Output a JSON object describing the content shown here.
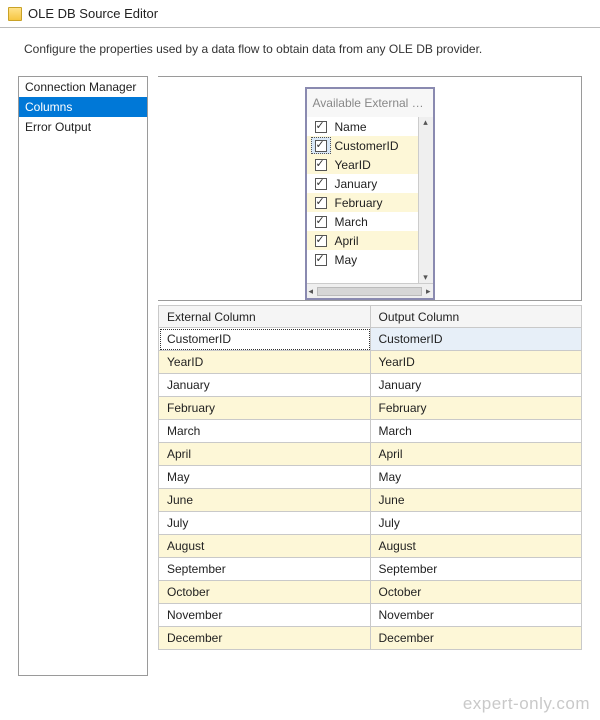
{
  "window": {
    "title": "OLE DB Source Editor"
  },
  "description": "Configure the properties used by a data flow to obtain data from any OLE DB provider.",
  "sidebar": {
    "items": [
      {
        "label": "Connection Manager",
        "selected": false
      },
      {
        "label": "Columns",
        "selected": true
      },
      {
        "label": "Error Output",
        "selected": false
      }
    ]
  },
  "available": {
    "title": "Available External C...",
    "columns": [
      {
        "label": "Name",
        "checked": true,
        "stripe": false,
        "selected": false
      },
      {
        "label": "CustomerID",
        "checked": true,
        "stripe": true,
        "selected": true
      },
      {
        "label": "YearID",
        "checked": true,
        "stripe": true,
        "selected": false
      },
      {
        "label": "January",
        "checked": true,
        "stripe": false,
        "selected": false
      },
      {
        "label": "February",
        "checked": true,
        "stripe": true,
        "selected": false
      },
      {
        "label": "March",
        "checked": true,
        "stripe": false,
        "selected": false
      },
      {
        "label": "April",
        "checked": true,
        "stripe": true,
        "selected": false
      },
      {
        "label": "May",
        "checked": true,
        "stripe": false,
        "selected": false
      }
    ]
  },
  "mapping": {
    "headers": {
      "external": "External Column",
      "output": "Output Column"
    },
    "rows": [
      {
        "external": "CustomerID",
        "output": "CustomerID",
        "stripe": false,
        "selected": true
      },
      {
        "external": "YearID",
        "output": "YearID",
        "stripe": true,
        "selected": false
      },
      {
        "external": "January",
        "output": "January",
        "stripe": false,
        "selected": false
      },
      {
        "external": "February",
        "output": "February",
        "stripe": true,
        "selected": false
      },
      {
        "external": "March",
        "output": "March",
        "stripe": false,
        "selected": false
      },
      {
        "external": "April",
        "output": "April",
        "stripe": true,
        "selected": false
      },
      {
        "external": "May",
        "output": "May",
        "stripe": false,
        "selected": false
      },
      {
        "external": "June",
        "output": "June",
        "stripe": true,
        "selected": false
      },
      {
        "external": "July",
        "output": "July",
        "stripe": false,
        "selected": false
      },
      {
        "external": "August",
        "output": "August",
        "stripe": true,
        "selected": false
      },
      {
        "external": "September",
        "output": "September",
        "stripe": false,
        "selected": false
      },
      {
        "external": "October",
        "output": "October",
        "stripe": true,
        "selected": false
      },
      {
        "external": "November",
        "output": "November",
        "stripe": false,
        "selected": false
      },
      {
        "external": "December",
        "output": "December",
        "stripe": true,
        "selected": false
      }
    ]
  },
  "watermark": "expert-only.com"
}
